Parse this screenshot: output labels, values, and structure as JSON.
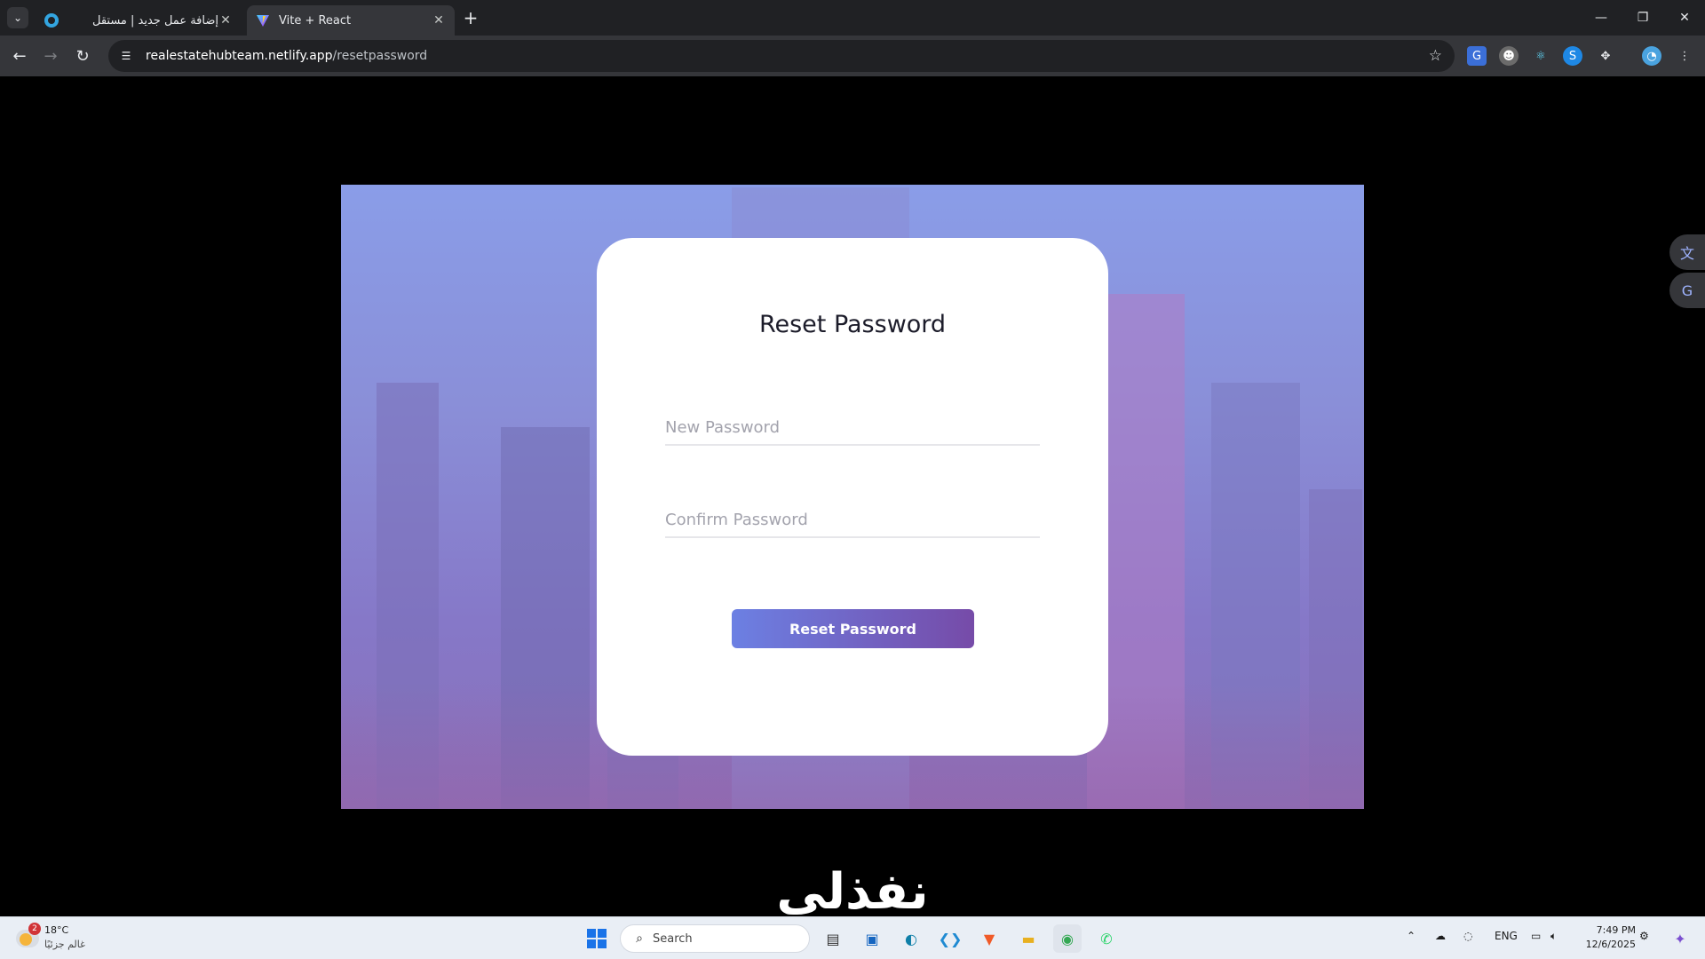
{
  "browser": {
    "tabs": [
      {
        "title": "إضافة عمل جديد | مستقل",
        "active": false,
        "favicon": "mostaql-icon"
      },
      {
        "title": "Vite + React",
        "active": true,
        "favicon": "vite-icon"
      }
    ],
    "url_host": "realestatehubteam.netlify.app",
    "url_path": "/resetpassword"
  },
  "page": {
    "title": "Reset Password",
    "new_password_placeholder": "New Password",
    "confirm_password_placeholder": "Confirm Password",
    "submit_label": "Reset Password",
    "logo_text": "نفذلي",
    "colors": {
      "button_gradient_start": "#6c80e3",
      "button_gradient_end": "#764ba8",
      "overlay_top": "#8a9de8",
      "overlay_bottom": "#8a70b8"
    }
  },
  "taskbar": {
    "weather_temp": "18°C",
    "weather_caption": "غالم جزئيًا",
    "weather_badge": "2",
    "search_label": "Search",
    "language": "ENG",
    "time": "7:49 PM",
    "date": "12/6/2025"
  }
}
